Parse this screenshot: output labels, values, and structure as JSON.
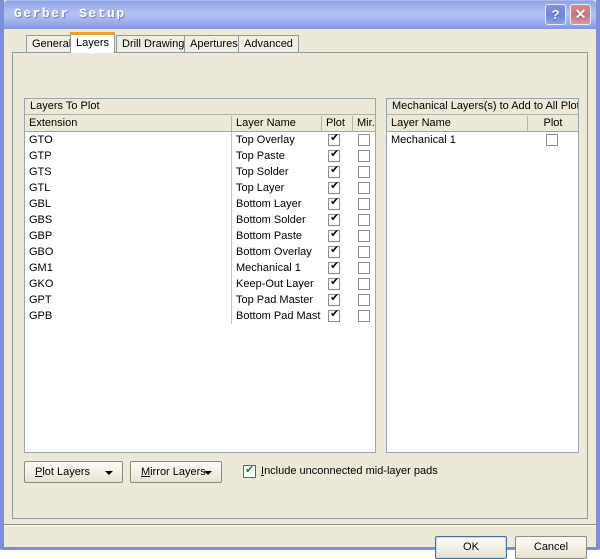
{
  "window": {
    "title": "Gerber Setup",
    "help_button": "?",
    "close_button": "✕",
    "accent_title_gradient": "#9fb0ec",
    "body_color": "#ece9d8",
    "frame_color": "#7b8fdd"
  },
  "tabs": [
    {
      "label": "General",
      "active": false
    },
    {
      "label": "Layers",
      "active": true
    },
    {
      "label": "Drill Drawing",
      "active": false
    },
    {
      "label": "Apertures",
      "active": false
    },
    {
      "label": "Advanced",
      "active": false
    }
  ],
  "left_panel": {
    "title": "Layers To Plot",
    "columns": [
      "Extension",
      "Layer Name",
      "Plot",
      "Mir..."
    ],
    "rows": [
      {
        "extension": "GTO",
        "layer_name": "Top Overlay",
        "plot": true,
        "mirror": false
      },
      {
        "extension": "GTP",
        "layer_name": "Top Paste",
        "plot": true,
        "mirror": false
      },
      {
        "extension": "GTS",
        "layer_name": "Top Solder",
        "plot": true,
        "mirror": false
      },
      {
        "extension": "GTL",
        "layer_name": "Top Layer",
        "plot": true,
        "mirror": false
      },
      {
        "extension": "GBL",
        "layer_name": "Bottom Layer",
        "plot": true,
        "mirror": false
      },
      {
        "extension": "GBS",
        "layer_name": "Bottom Solder",
        "plot": true,
        "mirror": false
      },
      {
        "extension": "GBP",
        "layer_name": "Bottom Paste",
        "plot": true,
        "mirror": false
      },
      {
        "extension": "GBO",
        "layer_name": "Bottom Overlay",
        "plot": true,
        "mirror": false
      },
      {
        "extension": "GM1",
        "layer_name": "Mechanical 1",
        "plot": true,
        "mirror": false
      },
      {
        "extension": "GKO",
        "layer_name": "Keep-Out Layer",
        "plot": true,
        "mirror": false
      },
      {
        "extension": "GPT",
        "layer_name": "Top Pad Master",
        "plot": true,
        "mirror": false
      },
      {
        "extension": "GPB",
        "layer_name": "Bottom Pad Mast",
        "plot": true,
        "mirror": false
      }
    ]
  },
  "right_panel": {
    "title": "Mechanical Layers(s) to Add to All Plots",
    "columns": [
      "Layer Name",
      "Plot"
    ],
    "rows": [
      {
        "layer_name": "Mechanical 1",
        "plot": false
      }
    ]
  },
  "bottom_controls": {
    "plot_layers_button": {
      "prefix": "",
      "accel": "P",
      "suffix": "lot Layers"
    },
    "mirror_layers_button": {
      "prefix": "",
      "accel": "M",
      "suffix": "irror Layers"
    },
    "include_pads": {
      "checked": true,
      "accel": "I",
      "suffix": "nclude unconnected mid-layer pads",
      "check_color": "#1a8a2e"
    }
  },
  "footer": {
    "ok_label": "OK",
    "cancel_label": "Cancel"
  },
  "glyphs": {
    "check": "✔",
    "arrow_down": "▼"
  }
}
